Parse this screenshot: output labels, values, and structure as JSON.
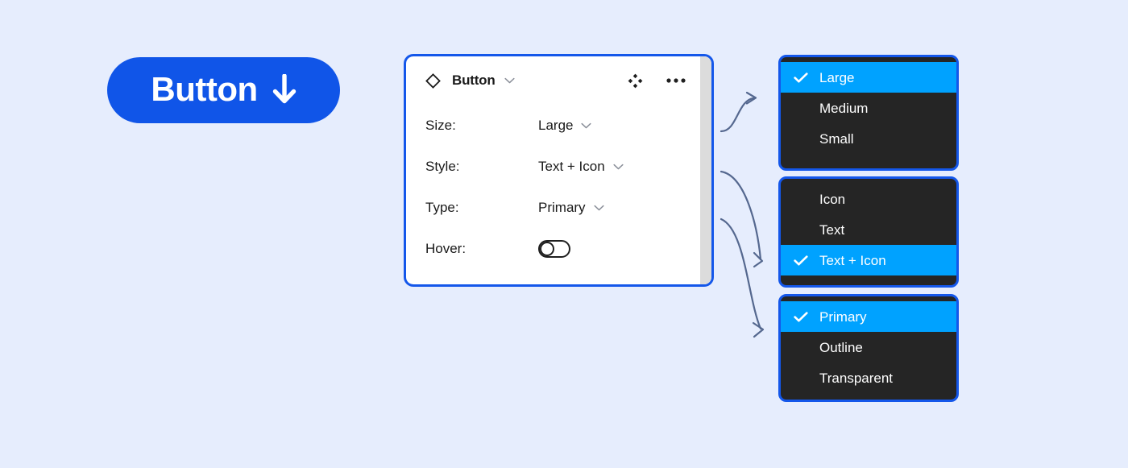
{
  "colors": {
    "background": "#e6edfd",
    "brand_blue": "#1055e8",
    "panel_border": "#1457ea",
    "menu_background": "#252525",
    "menu_highlight": "#00a2ff",
    "text_dark": "#1a1a1a",
    "text_light": "#ffffff",
    "scroll_strip": "#dcdcdc",
    "connector": "#55688f"
  },
  "hero_button": {
    "label": "Button",
    "icon": "arrow-down-icon"
  },
  "panel": {
    "header": {
      "component_icon": "diamond-outline-icon",
      "title": "Button",
      "title_chevron": "chevron-down-icon",
      "variant_icon": "four-diamond-variant-icon",
      "more_icon": "ellipsis-horizontal-icon"
    },
    "rows": [
      {
        "label": "Size:",
        "value": "Large",
        "control": "dropdown",
        "chevron": "chevron-down-icon"
      },
      {
        "label": "Style:",
        "value": "Text + Icon",
        "control": "dropdown",
        "chevron": "chevron-down-icon"
      },
      {
        "label": "Type:",
        "value": "Primary",
        "control": "dropdown",
        "chevron": "chevron-down-icon"
      },
      {
        "label": "Hover:",
        "value": "Off",
        "control": "toggle",
        "toggle_on": false
      }
    ]
  },
  "dropdowns": [
    {
      "name": "size",
      "items": [
        {
          "label": "Large",
          "selected": true
        },
        {
          "label": "Medium",
          "selected": false
        },
        {
          "label": "Small",
          "selected": false
        }
      ]
    },
    {
      "name": "style",
      "items": [
        {
          "label": "Icon",
          "selected": false
        },
        {
          "label": "Text",
          "selected": false
        },
        {
          "label": "Text + Icon",
          "selected": true
        }
      ]
    },
    {
      "name": "type",
      "items": [
        {
          "label": "Primary",
          "selected": true
        },
        {
          "label": "Outline",
          "selected": false
        },
        {
          "label": "Transparent",
          "selected": false
        }
      ]
    }
  ],
  "connectors": [
    {
      "from": "size-field",
      "to": "size-dropdown"
    },
    {
      "from": "style-field",
      "to": "style-dropdown"
    },
    {
      "from": "type-field",
      "to": "type-dropdown"
    }
  ]
}
